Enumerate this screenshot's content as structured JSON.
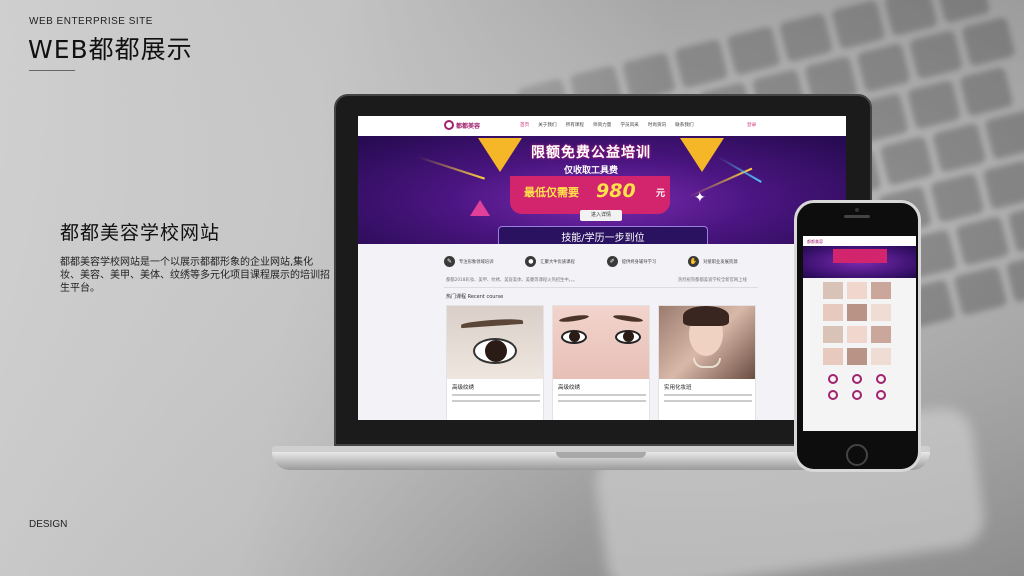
{
  "header": {
    "subtitle": "WEB ENTERPRISE SITE",
    "title": "WEB都都展示"
  },
  "project": {
    "title": "都都美容学校网站",
    "description": "都都美容学校网站是一个以展示都都形象的企业网站,集化妆、美容、美甲、美体、纹绣等多元化项目课程展示的培训招生平台。"
  },
  "footer": {
    "label": "DESIGN"
  },
  "site": {
    "logo_text": "都都美容",
    "nav": [
      "首页",
      "关于我们",
      "所有课程",
      "师资力量",
      "学员风采",
      "时尚资讯",
      "联系我们"
    ],
    "nav_active": 0,
    "login": "登录",
    "banner": {
      "title": "限额免费公益培训",
      "subtitle": "仅收取工具费",
      "price_label": "最低仅需要",
      "price": "980",
      "unit": "元",
      "button": "进入详情",
      "bottom": "技能/学历一步到位"
    },
    "features": [
      {
        "icon": "pen-icon",
        "text": "专注形象领域培训"
      },
      {
        "icon": "drop-icon",
        "text": "汇聚大牛优质课程"
      },
      {
        "icon": "brush-icon",
        "text": "提供终身辅导学习"
      },
      {
        "icon": "hand-icon",
        "text": "对接职业发展资源"
      }
    ],
    "intro_left": "都都2018彩妆、美甲、纹绣、美容美体、美睫等课程火热招生中。。。",
    "intro_right": "热烈祝贺都都美容学校全新官网上线",
    "section_title": "热门课程  Recent course",
    "courses": [
      {
        "title": "高级纹绣"
      },
      {
        "title": "高级纹绣"
      },
      {
        "title": "实用化妆班"
      }
    ]
  }
}
